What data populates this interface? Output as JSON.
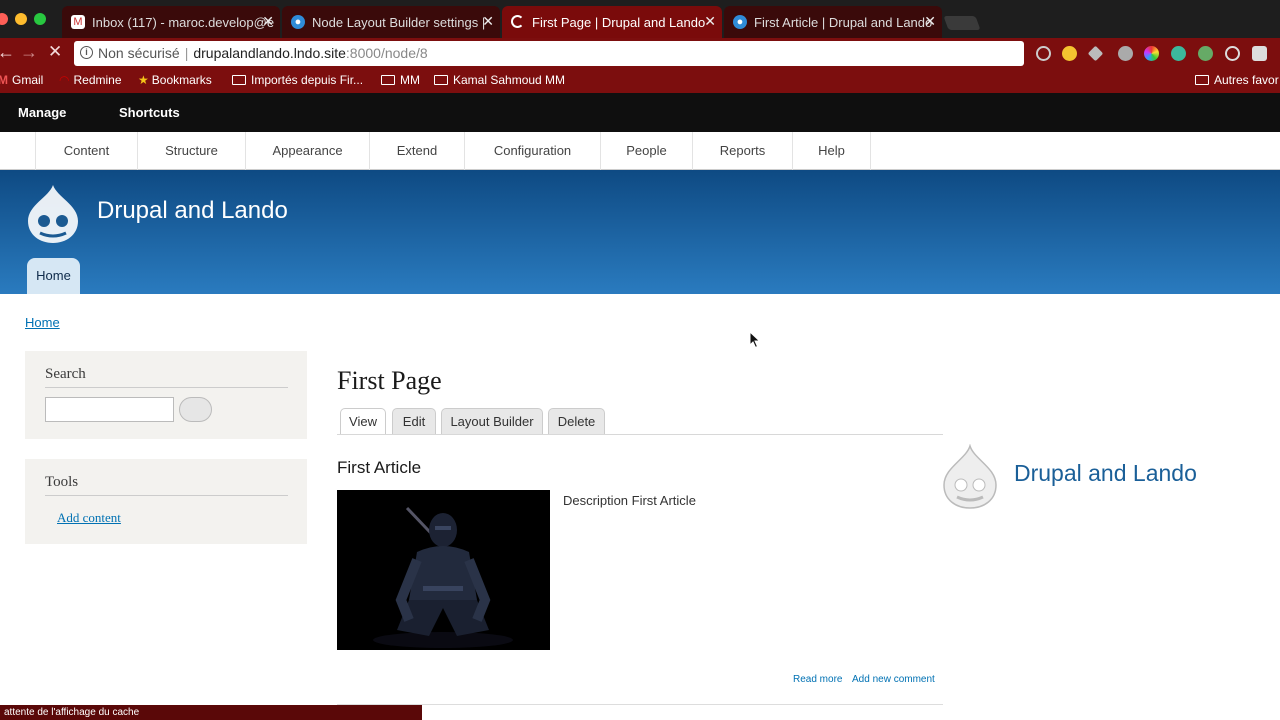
{
  "browser": {
    "tabs": [
      {
        "title": "Inbox (117) - maroc.develop@e"
      },
      {
        "title": "Node Layout Builder settings |"
      },
      {
        "title": "First Page | Drupal and Lando"
      },
      {
        "title": "First Article | Drupal and Lando"
      }
    ],
    "address": {
      "security": "Non sécurisé",
      "host": "drupalandlando.lndo.site",
      "port_path": ":8000/node/8"
    },
    "bookmarks": [
      "Gmail",
      "Redmine",
      "Bookmarks",
      "Importés depuis Fir...",
      "MM",
      "Kamal Sahmoud MM"
    ],
    "other_bookmarks": "Autres favor",
    "status": "attente de l'affichage du cache"
  },
  "admin": {
    "manage": "Manage",
    "shortcuts": "Shortcuts",
    "tray": [
      "Content",
      "Structure",
      "Appearance",
      "Extend",
      "Configuration",
      "People",
      "Reports",
      "Help"
    ]
  },
  "site": {
    "name": "Drupal and Lando",
    "home_tab": "Home"
  },
  "breadcrumb": "Home",
  "sidebar": {
    "search_title": "Search",
    "tools_title": "Tools",
    "add_content": "Add content"
  },
  "page": {
    "title": "First Page",
    "local_tasks": [
      "View",
      "Edit",
      "Layout Builder",
      "Delete"
    ]
  },
  "article": {
    "title": "First Article",
    "description": "Description First Article",
    "read_more": "Read more",
    "add_comment": "Add new comment"
  },
  "branding": {
    "name": "Drupal and Lando"
  },
  "colors": {
    "header_top": "#0e4a83",
    "header_bottom": "#2a7bbf",
    "link": "#0071b3",
    "chrome": "#7c0e0e"
  }
}
